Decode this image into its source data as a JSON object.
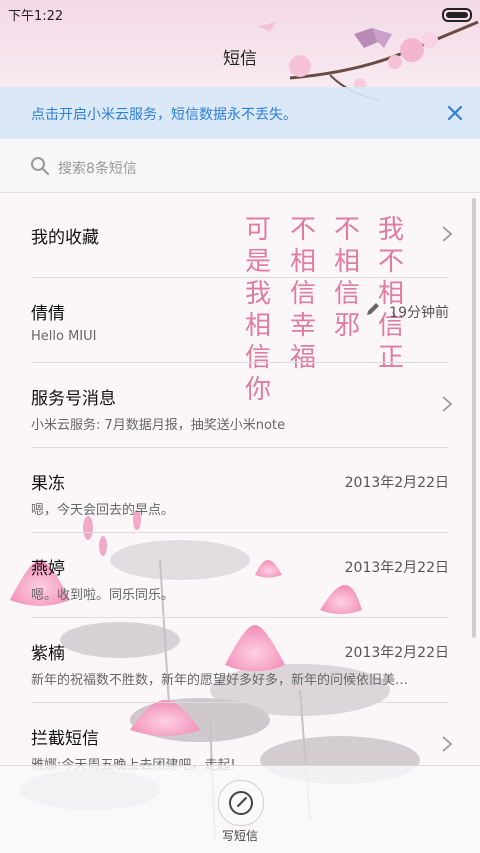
{
  "status_bar": {
    "time": "下午1:22"
  },
  "header": {
    "title": "短信"
  },
  "banner": {
    "text": "点击开启小米云服务，短信数据永不丢失。"
  },
  "search": {
    "placeholder": "搜索8条短信"
  },
  "conversations": [
    {
      "name": "我的收藏",
      "snippet": "",
      "time": ""
    },
    {
      "name": "倩倩",
      "snippet": "Hello MIUI",
      "time": "19分钟前"
    },
    {
      "name": "服务号消息",
      "snippet": "小米云服务: 7月数据月报，抽奖送小米note",
      "time": ""
    },
    {
      "name": "果冻",
      "snippet": "嗯，今天会回去的早点。",
      "time": "2013年2月22日"
    },
    {
      "name": "燕婷",
      "snippet": "嗯。收到啦。同乐同乐。",
      "time": "2013年2月22日"
    },
    {
      "name": "紫楠",
      "snippet": "新年的祝福数不胜数，新年的愿望好多好多，新年的问候依旧美…",
      "time": "2013年2月22日"
    },
    {
      "name": "拦截短信",
      "snippet": "雅娜:今天周五晚上去团建吧，走起!",
      "time": ""
    }
  ],
  "wallpaper_text": {
    "col1": "我不相信正",
    "col2": "不相信邪",
    "col3": "不相信幸福",
    "col4": "可是我相信你"
  },
  "bottom": {
    "compose_label": "写短信"
  },
  "colors": {
    "accent": "#2e7fd6",
    "handwriting": "#e07ba1",
    "banner_bg": "#d7e7f8"
  }
}
